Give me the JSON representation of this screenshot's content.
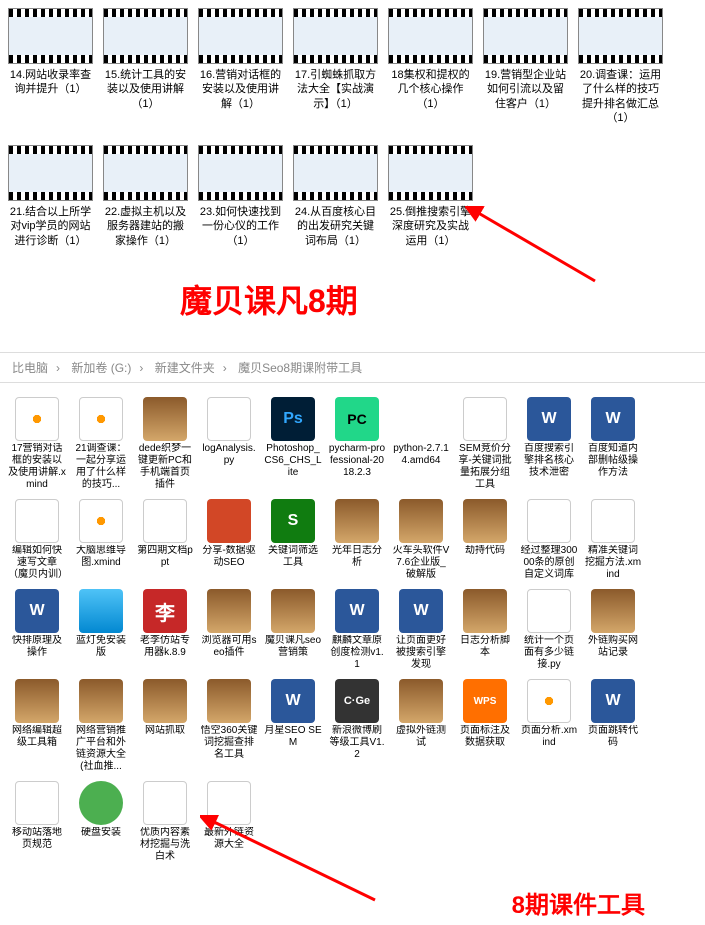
{
  "videos_row1": [
    {
      "label": "14.网站收录率查询并提升（1）"
    },
    {
      "label": "15.统计工具的安装以及使用讲解（1）"
    },
    {
      "label": "16.营销对话框的安装以及使用讲解（1）"
    },
    {
      "label": "17.引蜘蛛抓取方法大全【实战演示】（1）"
    },
    {
      "label": "18集权和提权的几个核心操作（1）"
    },
    {
      "label": "19.营销型企业站如何引流以及留住客户（1）"
    },
    {
      "label": "20.调查课：运用了什么样的技巧提升排名做汇总（1）"
    }
  ],
  "videos_row2": [
    {
      "label": "21.结合以上所学对vip学员的网站进行诊断（1）"
    },
    {
      "label": "22.虚拟主机以及服务器建站的搬家操作（1）"
    },
    {
      "label": "23.如何快速找到一份心仪的工作（1）"
    },
    {
      "label": "24.从百度核心目的出发研究关键词布局（1）"
    },
    {
      "label": "25.倒推搜索引擎深度研究及实战运用（1）"
    }
  ],
  "title1": "魔贝课凡8期",
  "breadcrumb": {
    "p1": "比电脑",
    "p2": "新加卷 (G:)",
    "p3": "新建文件夹",
    "p4": "魔贝Seo8期课附带工具"
  },
  "files": [
    {
      "label": "17营销对话框的安装以及使用讲解.xmind",
      "ic": "xmind"
    },
    {
      "label": "21调查课：一起分享运用了什么样的技巧...",
      "ic": "xmind"
    },
    {
      "label": "dede织梦一键更新PC和手机端首页插件",
      "ic": "zip"
    },
    {
      "label": "logAnalysis.py",
      "ic": "txt"
    },
    {
      "label": "Photoshop_CS6_CHS_Lite",
      "ic": "ps",
      "txt": "Ps"
    },
    {
      "label": "pycharm-professional-2018.2.3",
      "ic": "pc",
      "txt": "PC"
    },
    {
      "label": "python-2.7.14.amd64",
      "ic": "py"
    },
    {
      "label": "SEM竞价分享-关键词批量拓展分组工具",
      "ic": "doc"
    },
    {
      "label": "百度搜索引擎排名核心技术泄密",
      "ic": "w",
      "txt": "W"
    },
    {
      "label": "百度知道内部删帖级操作方法",
      "ic": "w",
      "txt": "W"
    },
    {
      "label": "编辑如何快速写文章（魔贝内训）",
      "ic": "doc"
    },
    {
      "label": "大脑思维导图.xmind",
      "ic": "xmind"
    },
    {
      "label": "第四期文档ppt",
      "ic": "doc"
    },
    {
      "label": "分享-数据驱动SEO",
      "ic": "ppt"
    },
    {
      "label": "关键词筛选工具",
      "ic": "s",
      "txt": "S"
    },
    {
      "label": "光年日志分析",
      "ic": "zip"
    },
    {
      "label": "火车头软件V7.6企业版_破解版",
      "ic": "zip"
    },
    {
      "label": "劫持代码",
      "ic": "zip"
    },
    {
      "label": "经过整理30000条的原创自定义词库",
      "ic": "txt"
    },
    {
      "label": "精准关键词挖掘方法.xmind",
      "ic": "doc"
    },
    {
      "label": "快排原理及操作",
      "ic": "w",
      "txt": "W"
    },
    {
      "label": "蓝灯免安装版",
      "ic": "exe"
    },
    {
      "label": "老李仿站专用器k.8.9",
      "ic": "li",
      "txt": "李"
    },
    {
      "label": "浏览器可用seo插件",
      "ic": "zip"
    },
    {
      "label": "魔贝课凡seo营销策",
      "ic": "zip"
    },
    {
      "label": "麒麟文章原创度检测v1.1",
      "ic": "w",
      "txt": "W"
    },
    {
      "label": "让页面更好被搜索引擎发现",
      "ic": "w",
      "txt": "W"
    },
    {
      "label": "日志分析脚本",
      "ic": "zip"
    },
    {
      "label": "统计一个页面有多少链接.py",
      "ic": "txt"
    },
    {
      "label": "外链购买网站记录",
      "ic": "zip"
    },
    {
      "label": "网络编辑超级工具箱",
      "ic": "zip"
    },
    {
      "label": "网络营销推广平台和外链资源大全(社血推...",
      "ic": "zip"
    },
    {
      "label": "网站抓取",
      "ic": "zip"
    },
    {
      "label": "悟空360关键词挖掘查排名工具",
      "ic": "zip"
    },
    {
      "label": "月星SEO SEM",
      "ic": "w",
      "txt": "W"
    },
    {
      "label": "新浪微博刷等级工具V1.2",
      "ic": "cge",
      "txt": "C·Ge"
    },
    {
      "label": "虚拟外链测试",
      "ic": "zip"
    },
    {
      "label": "页面标注及数据获取",
      "ic": "wps",
      "txt": "WPS"
    },
    {
      "label": "页面分析.xmind",
      "ic": "xmind"
    },
    {
      "label": "页面跳转代码",
      "ic": "w",
      "txt": "W"
    },
    {
      "label": "移动站落地页规范",
      "ic": "doc"
    },
    {
      "label": "硬盘安装",
      "ic": "green"
    },
    {
      "label": "优质内容素材挖掘与洗白术",
      "ic": "txt"
    },
    {
      "label": "最新外链资源大全",
      "ic": "txt"
    }
  ],
  "title2": "8期课件工具"
}
